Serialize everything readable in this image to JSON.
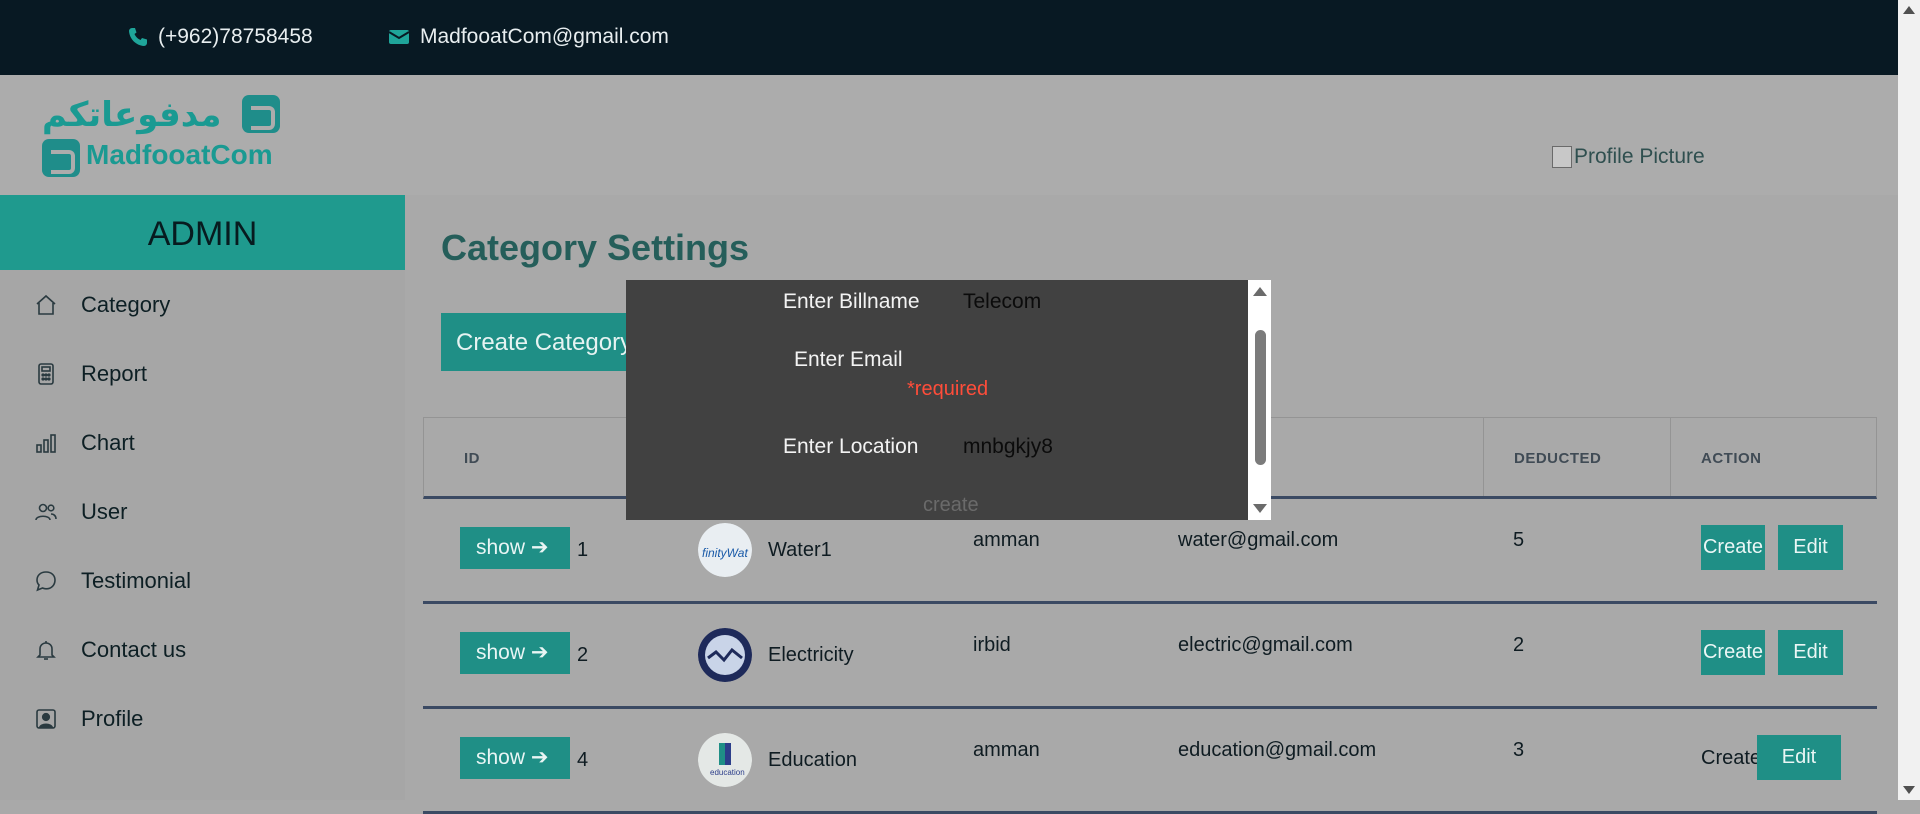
{
  "topbar": {
    "phone": "(+962)78758458",
    "email": "MadfooatCom@gmail.com"
  },
  "logo": {
    "arabic": "مدفوعاتكم",
    "english": "MadfooatCom"
  },
  "header": {
    "profile_alt": "Profile Picture"
  },
  "sidebar": {
    "title": "ADMIN",
    "items": [
      {
        "label": "Category",
        "icon": "house-icon"
      },
      {
        "label": "Report",
        "icon": "calculator-icon"
      },
      {
        "label": "Chart",
        "icon": "bar-chart-icon"
      },
      {
        "label": "User",
        "icon": "people-icon"
      },
      {
        "label": "Testimonial",
        "icon": "chat-icon"
      },
      {
        "label": "Contact us",
        "icon": "bell-icon"
      },
      {
        "label": "Profile",
        "icon": "person-square-icon"
      }
    ]
  },
  "main": {
    "title": "Category Settings",
    "create_button": "Create Category",
    "columns": {
      "id": "ID",
      "deducted": "DEDUCTED",
      "action": "ACTION"
    },
    "rows": [
      {
        "show": "show",
        "id": "1",
        "name": "Water1",
        "location": "amman",
        "email": "water@gmail.com",
        "deducted": "5",
        "create": "Create",
        "edit": "Edit"
      },
      {
        "show": "show",
        "id": "2",
        "name": "Electricity",
        "location": "irbid",
        "email": "electric@gmail.com",
        "deducted": "2",
        "create": "Create",
        "edit": "Edit"
      },
      {
        "show": "show",
        "id": "4",
        "name": "Education",
        "location": "amman",
        "email": "education@gmail.com",
        "deducted": "3",
        "create": "Create",
        "edit": "Edit"
      }
    ]
  },
  "modal": {
    "billname_label": "Enter Billname",
    "billname_value": "Telecom",
    "email_label": "Enter Email",
    "email_value": "",
    "required_text": "*required",
    "location_label": "Enter Location",
    "location_value": "mnbgkjy8",
    "create_label": "create"
  },
  "colors": {
    "accent": "#1f8f86",
    "topbar": "#081923",
    "modal": "#414141",
    "error": "#ff4d3a"
  }
}
